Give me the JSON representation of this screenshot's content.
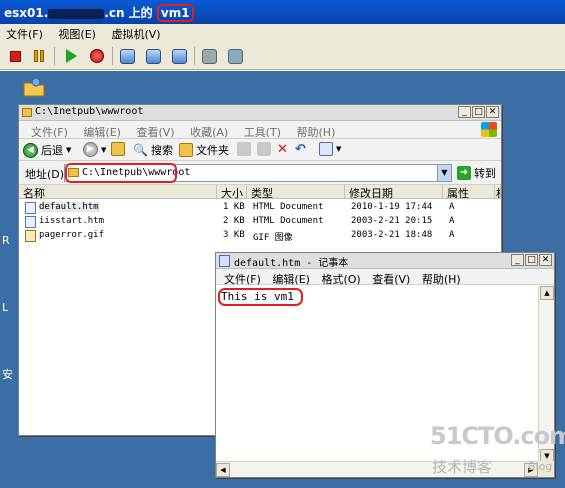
{
  "vm_window": {
    "title_prefix": "esx01.",
    "title_suffix": ".cn 上的",
    "vm_name": "vm1",
    "menu": [
      "文件(F)",
      "视图(E)",
      "虚拟机(V)"
    ]
  },
  "desktop": {
    "side_letters": [
      "R",
      "L",
      "安"
    ]
  },
  "explorer": {
    "title": "C:\\Inetpub\\wwwroot",
    "menu": [
      "文件(F)",
      "编辑(E)",
      "查看(V)",
      "收藏(A)",
      "工具(T)",
      "帮助(H)"
    ],
    "toolbar": {
      "back": "后退",
      "search": "搜索",
      "folders": "文件夹"
    },
    "address_label": "地址(D)",
    "address_value": "C:\\Inetpub\\wwwroot",
    "go_label": "转到",
    "columns": [
      "名称",
      "大小",
      "类型",
      "修改日期",
      "属性",
      "相"
    ],
    "files": [
      {
        "name": "default.htm",
        "size": "1 KB",
        "type": "HTML Document",
        "modified": "2010-1-19 17:44",
        "attr": "A"
      },
      {
        "name": "iisstart.htm",
        "size": "2 KB",
        "type": "HTML Document",
        "modified": "2003-2-21 20:15",
        "attr": "A"
      },
      {
        "name": "pagerror.gif",
        "size": "3 KB",
        "type": "GIF 图像",
        "modified": "2003-2-21 18:48",
        "attr": "A"
      }
    ]
  },
  "notepad": {
    "title": "default.htm - 记事本",
    "menu": [
      "文件(F)",
      "编辑(E)",
      "格式(O)",
      "查看(V)",
      "帮助(H)"
    ],
    "content": "This is vm1"
  },
  "watermark": {
    "site": "51CTO.com",
    "caption": "技术博客",
    "tag": "Blog"
  }
}
